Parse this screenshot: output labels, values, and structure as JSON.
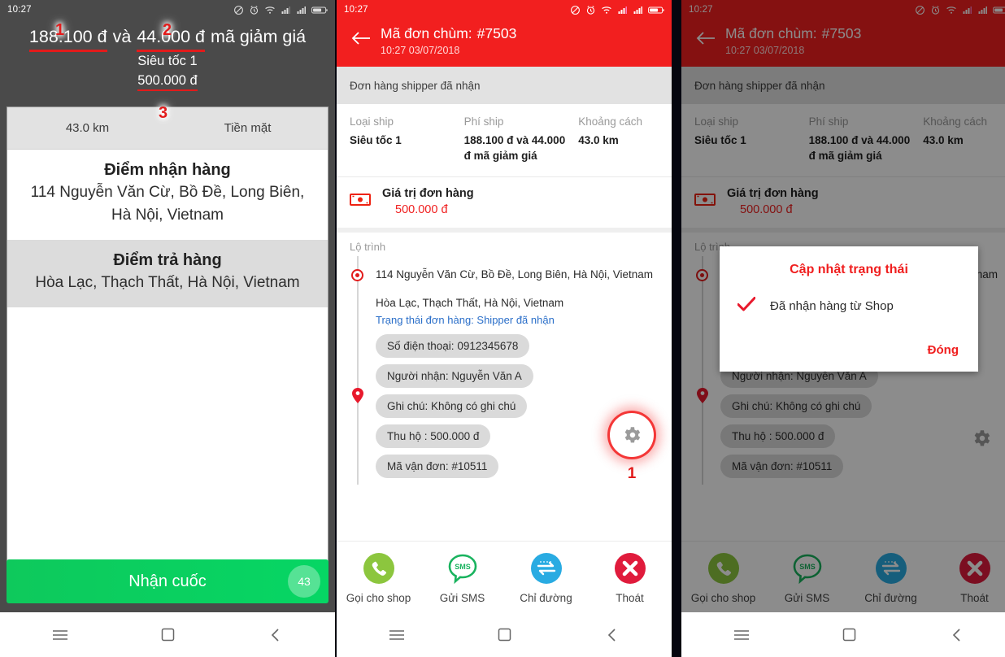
{
  "statusbar": {
    "time": "10:27"
  },
  "navbar": {
    "menu_icon": "menu-icon",
    "home_icon": "home-square-icon",
    "back_icon": "back-chevron-icon"
  },
  "panel1": {
    "fare_main": "188.100 đ",
    "fare_mid": "và",
    "fare_discount": "44.000 đ",
    "fare_suffix": "mã giảm giá",
    "ship_type": "Siêu tốc 1",
    "cod_amount": "500.000 đ",
    "markers": {
      "m1": "1",
      "m2": "2",
      "m3": "3"
    },
    "meta": {
      "distance": "43.0 km",
      "payment": "Tiền mặt"
    },
    "pickup": {
      "title": "Điểm nhận hàng",
      "address": "114 Nguyễn Văn Cừ, Bồ Đề, Long Biên, Hà Nội, Vietnam"
    },
    "dropoff": {
      "title": "Điểm trả hàng",
      "address": "Hòa Lạc, Thạch Thất, Hà Nội, Vietnam"
    },
    "accept_button": {
      "label": "Nhận cuốc",
      "badge": "43"
    }
  },
  "panel2": {
    "appbar": {
      "back_icon": "arrow-back-icon",
      "title": "Mã đơn chùm:",
      "code": "#7503",
      "subtitle": "10:27 03/07/2018"
    },
    "status_strip": "Đơn hàng shipper đã nhận",
    "info": {
      "headers": [
        "Loại ship",
        "Phí ship",
        "Khoảng cách"
      ],
      "values": [
        "Siêu tốc 1",
        "188.100 đ và 44.000 đ mã giảm giá",
        "43.0 km"
      ]
    },
    "order_value": {
      "title": "Giá trị đơn hàng",
      "amount": "500.000 đ",
      "icon": "banknote-icon"
    },
    "route": {
      "label": "Lộ trình",
      "pickup": "114 Nguyễn Văn Cừ, Bồ Đề, Long Biên, Hà Nội, Vietnam",
      "dropoff": "Hòa Lạc, Thạch Thất, Hà Nội, Vietnam",
      "status": "Trạng thái đơn hàng: Shipper đã nhận",
      "chips": [
        "Số điện thoại: 0912345678",
        "Người nhận: Nguyễn Văn A",
        "Ghi chú: Không có ghi chú",
        "Thu hộ :   500.000 đ",
        "Mã vận đơn: #10511"
      ]
    },
    "gear": {
      "icon": "gear-icon",
      "marker": "1"
    },
    "actions": [
      {
        "label": "Gọi cho shop",
        "icon": "phone-icon",
        "color": "#8cc63e"
      },
      {
        "label": "Gửi SMS",
        "icon": "sms-bubble-icon",
        "color": "#19b35e"
      },
      {
        "label": "Chỉ đường",
        "icon": "directions-arrows-icon",
        "color": "#29abe2"
      },
      {
        "label": "Thoát",
        "icon": "close-circle-icon",
        "color": "#e01b3c"
      }
    ]
  },
  "panel3": {
    "dialog": {
      "title": "Cập nhật trạng thái",
      "option": "Đã nhận hàng từ Shop",
      "check_icon": "check-icon",
      "close_label": "Đóng"
    }
  }
}
